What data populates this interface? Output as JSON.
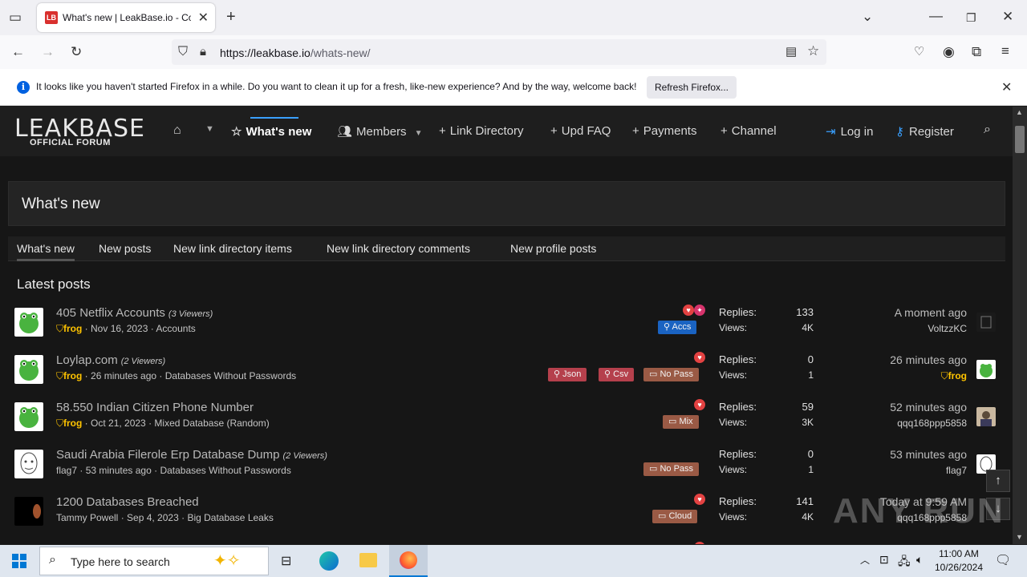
{
  "browser": {
    "tab_title": "What's new | LeakBase.io - Con",
    "tab_favicon": "LB",
    "url_host": "https://leakbase.io",
    "url_path": "/whats-new/"
  },
  "notification": {
    "message": "It looks like you haven't started Firefox in a while. Do you want to clean it up for a fresh, like-new experience? And by the way, welcome back!",
    "button": "Refresh Firefox..."
  },
  "site": {
    "logo_main": "LEAKBASE",
    "logo_sub": "OFFICIAL FORUM",
    "nav": {
      "whats_new": "What's new",
      "members": "Members",
      "link_directory": "Link Directory",
      "upd_faq": "Upd FAQ",
      "payments": "Payments",
      "channel": "Channel",
      "login": "Log in",
      "register": "Register"
    }
  },
  "page": {
    "title": "What's new",
    "subtabs": [
      "What's new",
      "New posts",
      "New link directory items",
      "New link directory comments",
      "New profile posts"
    ],
    "section_title": "Latest posts",
    "replies_label": "Replies:",
    "views_label": "Views:"
  },
  "posts": [
    {
      "title": "405 Netflix Accounts",
      "viewers": "(3 Viewers)",
      "author": "frog",
      "date": "Nov 16, 2023",
      "forum": "Accounts",
      "prefixes": [
        "Accs"
      ],
      "replies": "133",
      "views": "4K",
      "last_time": "A moment ago",
      "last_user": "VoltzzKC"
    },
    {
      "title": "Loylap.com",
      "viewers": "(2 Viewers)",
      "author": "frog",
      "date": "26 minutes ago",
      "forum": "Databases Without Passwords",
      "prefixes": [
        "Json",
        "Csv",
        "No Pass"
      ],
      "replies": "0",
      "views": "1",
      "last_time": "26 minutes ago",
      "last_user": "frog"
    },
    {
      "title": "58.550 Indian Citizen Phone Number",
      "viewers": "",
      "author": "frog",
      "date": "Oct 21, 2023",
      "forum": "Mixed Database (Random)",
      "prefixes": [
        "Mix"
      ],
      "replies": "59",
      "views": "3K",
      "last_time": "52 minutes ago",
      "last_user": "qqq168ppp5858"
    },
    {
      "title": "Saudi Arabia Filerole Erp Database Dump",
      "viewers": "(2 Viewers)",
      "author": "flag7",
      "date": "53 minutes ago",
      "forum": "Databases Without Passwords",
      "prefixes": [
        "No Pass"
      ],
      "replies": "0",
      "views": "1",
      "last_time": "53 minutes ago",
      "last_user": "flag7"
    },
    {
      "title": "1200 Databases Breached",
      "viewers": "",
      "author": "Tammy Powell",
      "date": "Sep 4, 2023",
      "forum": "Big Database Leaks",
      "prefixes": [
        "Cloud"
      ],
      "replies": "141",
      "views": "4K",
      "last_time": "Today at 9:59 AM",
      "last_user": "qqq168ppp5858"
    }
  ],
  "colors": {
    "accs": "#1a63c2",
    "json": "#b5404c",
    "csv": "#b5404c",
    "nopass": "#9a5a45",
    "mix": "#9a5a45",
    "cloud": "#9a5a45",
    "heart": "#e34242",
    "frog": "#ffc400"
  },
  "watermark": "ANY RUN",
  "taskbar": {
    "search_placeholder": "Type here to search",
    "time": "11:00 AM",
    "date": "10/26/2024"
  }
}
